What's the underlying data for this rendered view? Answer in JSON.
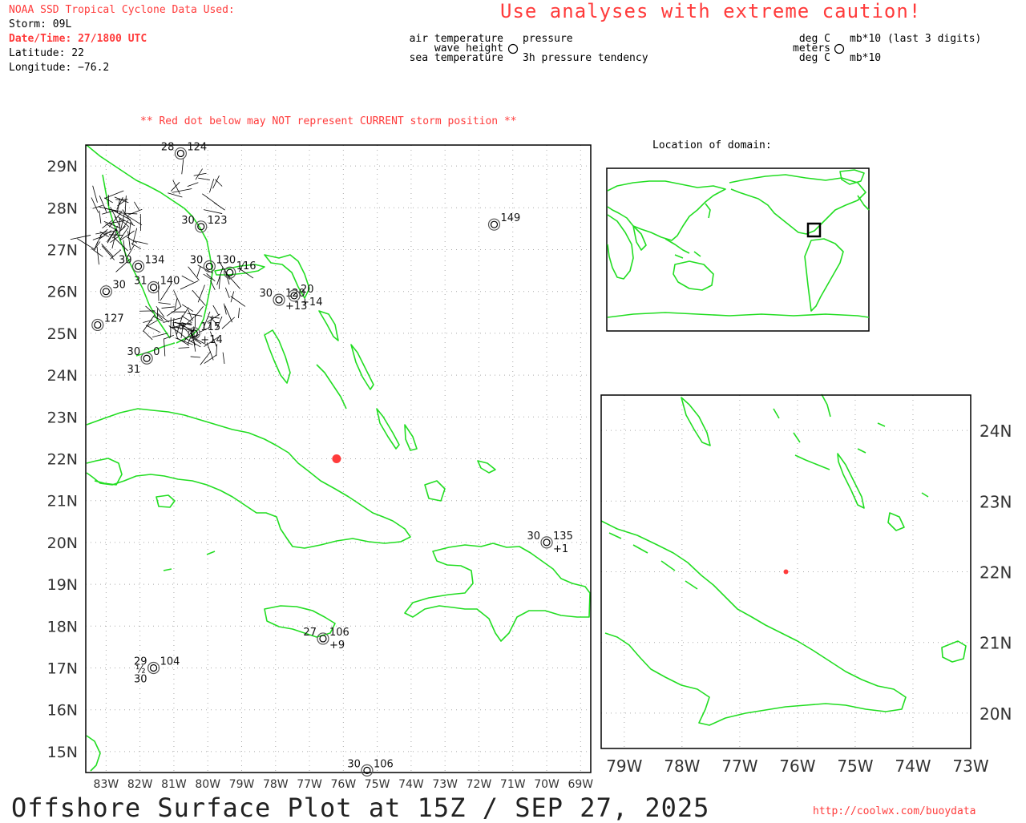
{
  "header": {
    "source_title": "NOAA SSD Tropical Cyclone Data Used:",
    "storm": "Storm: 09L",
    "datetime": "Date/Time: 27/1800 UTC",
    "latitude": "Latitude: 22",
    "longitude": "Longitude: −76.2",
    "caution": "Use analyses with extreme caution!"
  },
  "legend": {
    "left": {
      "air_temp": "air temperature",
      "wave_height": "wave height",
      "sea_temp": "sea temperature",
      "pressure": "pressure",
      "tendency": "3h pressure tendency"
    },
    "right": {
      "deg_c_top": "deg C",
      "meters": "meters",
      "deg_c_bottom": "deg C",
      "mb_top": "mb*10 (last 3 digits)",
      "mb_bottom": "mb*10"
    }
  },
  "notices": {
    "red_dot_warning": "** Red dot below may NOT represent CURRENT storm position **",
    "domain_title": "Location of domain:"
  },
  "footer": {
    "plot_title": "Offshore Surface Plot at 15Z / SEP 27, 2025",
    "url": "http://coolwx.com/buoydata"
  },
  "main_map": {
    "lat_labels": [
      "29N",
      "28N",
      "27N",
      "26N",
      "25N",
      "24N",
      "23N",
      "22N",
      "21N",
      "20N",
      "19N",
      "18N",
      "17N",
      "16N",
      "15N"
    ],
    "lon_labels": [
      "83W",
      "82W",
      "81W",
      "80W",
      "79W",
      "78W",
      "77W",
      "76W",
      "75W",
      "74W",
      "73W",
      "72W",
      "71W",
      "70W",
      "69W"
    ],
    "storm_position": {
      "lat": 22.0,
      "lon": -76.2
    },
    "colors": {
      "coast": "#22dd22",
      "storm": "#ff3b3b"
    },
    "stations": [
      {
        "lat": 27.6,
        "lon": -71.55,
        "pressure": "149"
      },
      {
        "lat": 20.0,
        "lon": -70.0,
        "air": "30",
        "pressure": "135",
        "tendency": "+1"
      },
      {
        "lat": 17.7,
        "lon": -76.6,
        "air": "27",
        "pressure": "106",
        "tendency": "+9"
      },
      {
        "lat": 17.0,
        "lon": -81.6,
        "air": "29",
        "pressure": "104",
        "sea": "30",
        "wave": "½"
      },
      {
        "lat": 14.55,
        "lon": -75.3,
        "air": "30",
        "pressure": "106"
      },
      {
        "lat": 25.8,
        "lon": -77.9,
        "air": "30",
        "pressure": "120",
        "tendency": "+13"
      },
      {
        "lat": 25.9,
        "lon": -77.45,
        "pressure": "20",
        "tendency": "+14"
      },
      {
        "lat": 26.0,
        "lon": -83.0,
        "pressure": "30"
      },
      {
        "lat": 25.2,
        "lon": -83.25,
        "pressure": "127"
      },
      {
        "lat": 26.6,
        "lon": -82.05,
        "air": "30",
        "pressure": "134"
      },
      {
        "lat": 26.1,
        "lon": -81.6,
        "air": "31",
        "pressure": "140"
      },
      {
        "lat": 27.55,
        "lon": -80.2,
        "air": "30",
        "pressure": "123"
      },
      {
        "lat": 29.3,
        "lon": -80.8,
        "air": "28",
        "pressure": "124"
      },
      {
        "lat": 24.4,
        "lon": -81.8,
        "air": "30",
        "pressure": "0",
        "sea": "31"
      },
      {
        "lat": 26.6,
        "lon": -79.95,
        "air": "30",
        "pressure": "130"
      },
      {
        "lat": 26.45,
        "lon": -79.35,
        "pressure": "116"
      },
      {
        "lat": 25.0,
        "lon": -80.4,
        "pressure": "115",
        "tendency": "+14"
      }
    ]
  },
  "inset_map": {
    "lat_labels": [
      "24N",
      "23N",
      "22N",
      "21N",
      "20N"
    ],
    "lon_labels": [
      "79W",
      "78W",
      "77W",
      "76W",
      "75W",
      "74W",
      "73W"
    ],
    "storm_position": {
      "lat": 22.0,
      "lon": -76.2
    }
  },
  "world_map": {
    "domain_box": {
      "lat_min": 15,
      "lat_max": 29,
      "lon_min": -84,
      "lon_max": -69
    }
  }
}
